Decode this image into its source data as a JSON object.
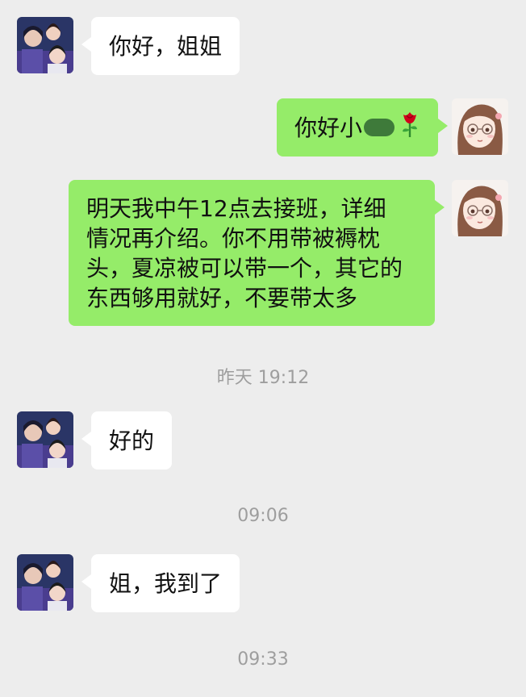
{
  "colors": {
    "background": "#ededed",
    "incoming_bubble": "#ffffff",
    "outgoing_bubble": "#95ec69",
    "timestamp_text": "#9e9e9e"
  },
  "messages": [
    {
      "direction": "incoming",
      "text": "你好，姐姐"
    },
    {
      "direction": "outgoing",
      "text_prefix": "你好小",
      "redacted": true,
      "emoji": "rose-icon"
    },
    {
      "direction": "outgoing",
      "lines": [
        "明天我中午12点去接班，详细",
        "情况再介绍。你不用带被褥枕",
        "头，夏凉被可以带一个，其它的",
        "东西够用就好，不要带太多"
      ]
    },
    {
      "direction": "incoming",
      "text": "好的"
    },
    {
      "direction": "incoming",
      "text": "姐，我到了"
    }
  ],
  "timestamps": [
    "昨天 19:12",
    "09:06",
    "09:33"
  ]
}
